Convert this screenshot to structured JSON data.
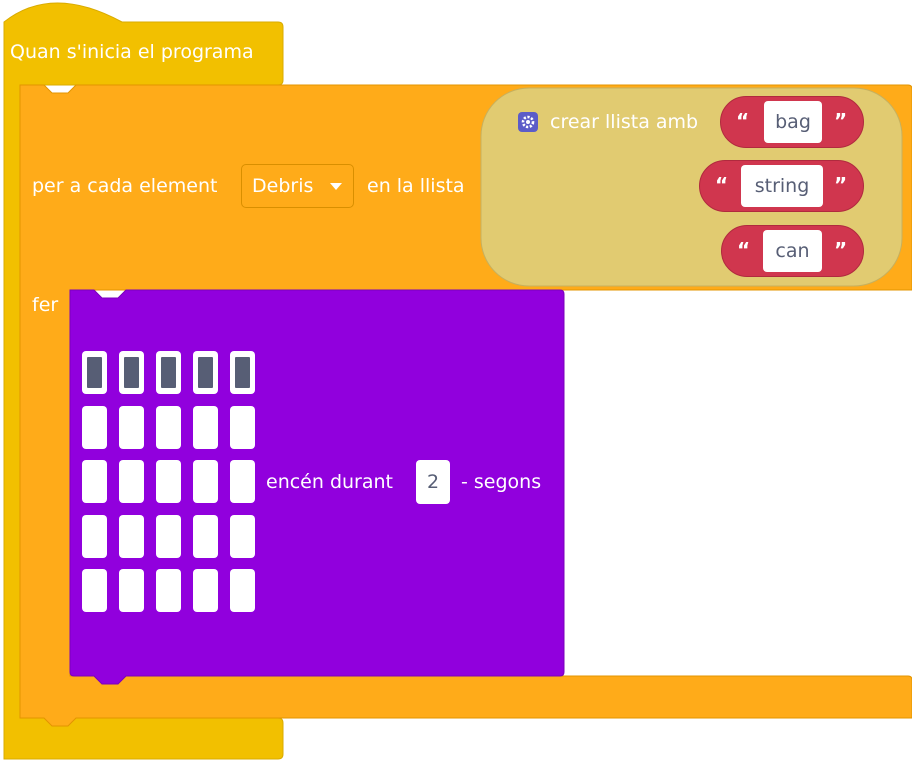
{
  "hat_block": {
    "label": "Quan s'inicia el programa",
    "color": "#f2c000"
  },
  "for_each_block": {
    "prefix": "per a cada element",
    "variable": "Debris",
    "middle": "en la llista",
    "do_label": "fer",
    "color": "#ffab19"
  },
  "list_block": {
    "icon": "gear-icon",
    "label": "crear llista amb",
    "items": [
      "bag",
      "string",
      "can"
    ],
    "color": "#e1cb71"
  },
  "text_block": {
    "color": "#d0364e",
    "open_quote": "“",
    "close_quote": "”"
  },
  "show_leds_block": {
    "duration_prefix": "encén durant",
    "duration_value": "2",
    "duration_suffix": "- segons",
    "color": "#9100dd",
    "grid": [
      [
        1,
        1,
        1,
        1,
        1
      ],
      [
        0,
        0,
        0,
        0,
        0
      ],
      [
        0,
        0,
        0,
        0,
        0
      ],
      [
        0,
        0,
        0,
        0,
        0
      ],
      [
        0,
        0,
        0,
        0,
        0
      ]
    ]
  }
}
